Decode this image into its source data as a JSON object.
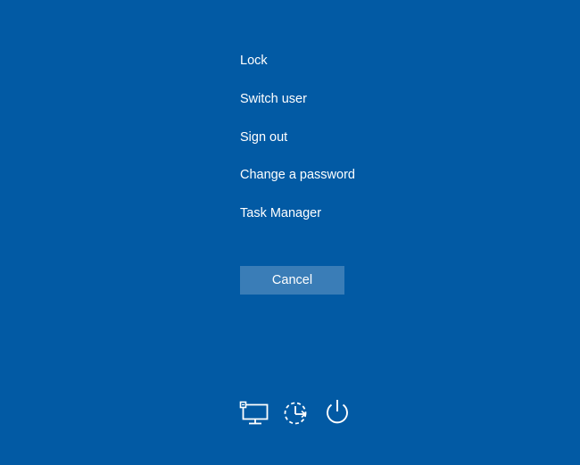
{
  "background_color": "#025aa4",
  "menu": {
    "items": [
      {
        "label": "Lock"
      },
      {
        "label": "Switch user"
      },
      {
        "label": "Sign out"
      },
      {
        "label": "Change a password"
      },
      {
        "label": "Task Manager"
      }
    ]
  },
  "cancel": {
    "label": "Cancel",
    "color": "#3a7db7"
  },
  "bottom_icons": [
    {
      "icon": "network-icon"
    },
    {
      "icon": "ease-of-access-icon"
    },
    {
      "icon": "power-icon"
    }
  ]
}
